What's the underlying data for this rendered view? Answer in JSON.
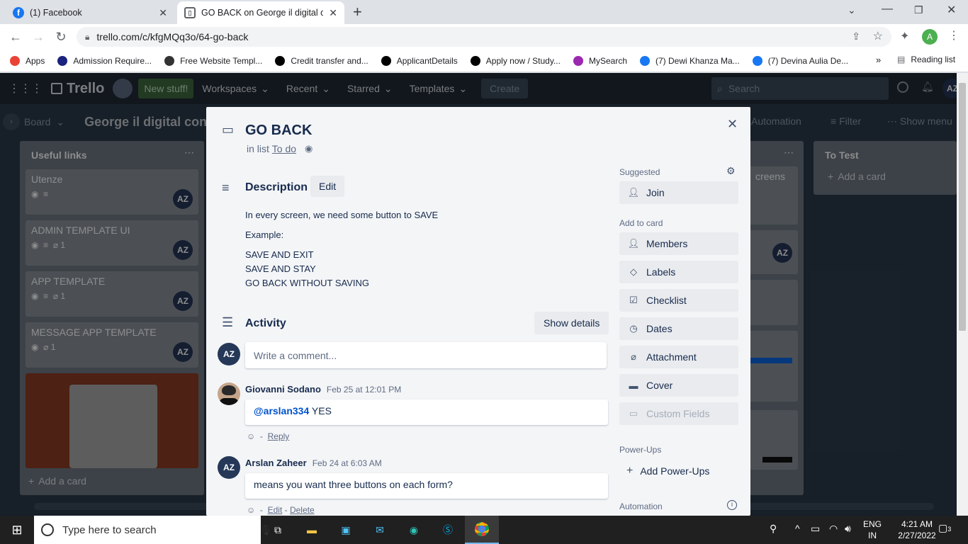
{
  "browser": {
    "tabs": [
      {
        "title": "(1) Facebook",
        "icon": "facebook-icon"
      },
      {
        "title": "GO BACK on George il digital cor",
        "icon": "trello-icon"
      }
    ],
    "url": "trello.com/c/kfgMQq3o/64-go-back",
    "profile_initial": "A",
    "bookmarks": [
      {
        "label": "Apps",
        "color": "#ea4335"
      },
      {
        "label": "Admission Require...",
        "color": "#1a237e"
      },
      {
        "label": "Free Website Templ...",
        "color": "#333333"
      },
      {
        "label": "Credit transfer and...",
        "color": "#000000"
      },
      {
        "label": "ApplicantDetails",
        "color": "#000000"
      },
      {
        "label": "Apply now / Study...",
        "color": "#000000"
      },
      {
        "label": "MySearch",
        "color": "#9c27b0"
      },
      {
        "label": "(7) Dewi Khanza Ma...",
        "color": "#1877f2"
      },
      {
        "label": "(7) Devina Aulia De...",
        "color": "#1877f2"
      }
    ],
    "more_bookmarks": "»",
    "reading_list": "Reading list"
  },
  "trello": {
    "logo": "Trello",
    "new_stuff": "New stuff!",
    "nav": [
      "Workspaces",
      "Recent",
      "Starred",
      "Templates"
    ],
    "create": "Create",
    "search_placeholder": "Search",
    "user_initials": "AZ",
    "board_view": "Board",
    "board_title": "George il digital con",
    "automation": "Automation",
    "filter": "Filter",
    "show_menu": "Show menu",
    "list1": {
      "title": "Useful links",
      "cards": [
        {
          "title": "Utenze",
          "badge": ""
        },
        {
          "title": "ADMIN TEMPLATE UI",
          "badge": "1"
        },
        {
          "title": "APP TEMPLATE",
          "badge": "1"
        },
        {
          "title": "MESSAGE APP TEMPLATE",
          "badge": "1"
        }
      ],
      "add_card": "Add a card"
    },
    "list2_fragment": "creens",
    "list3": {
      "title": "To Test",
      "add_card": "Add a card"
    }
  },
  "card": {
    "title": "GO BACK",
    "in_list_prefix": "in list",
    "list_name": "To do",
    "description_heading": "Description",
    "edit": "Edit",
    "description": [
      "In every screen, we need some button to SAVE",
      "Example:",
      "SAVE AND EXIT",
      "SAVE AND STAY",
      "GO BACK WITHOUT SAVING"
    ],
    "activity_heading": "Activity",
    "show_details": "Show details",
    "comment_placeholder": "Write a comment...",
    "current_user": "AZ",
    "comments": [
      {
        "author": "Giovanni Sodano",
        "time": "Feb 25 at 12:01 PM",
        "mention": "@arslan334",
        "text": " YES",
        "actions": [
          "Reply"
        ]
      },
      {
        "author": "Arslan Zaheer",
        "initials": "AZ",
        "time": "Feb 24 at 6:03 AM",
        "mention": "",
        "text": "means you want three buttons on each form?",
        "actions": [
          "Edit",
          "Delete"
        ]
      }
    ],
    "sidebar": {
      "suggested": "Suggested",
      "join": "Join",
      "add_to_card": "Add to card",
      "add_items": [
        {
          "label": "Members",
          "icon": "person-icon"
        },
        {
          "label": "Labels",
          "icon": "label-icon"
        },
        {
          "label": "Checklist",
          "icon": "checklist-icon"
        },
        {
          "label": "Dates",
          "icon": "clock-icon"
        },
        {
          "label": "Attachment",
          "icon": "paperclip-icon"
        },
        {
          "label": "Cover",
          "icon": "cover-icon"
        },
        {
          "label": "Custom Fields",
          "icon": "custom-fields-icon"
        }
      ],
      "power_ups": "Power-Ups",
      "add_power_ups": "Add Power-Ups",
      "automation": "Automation"
    }
  },
  "taskbar": {
    "search_placeholder": "Type here to search",
    "lang": "ENG",
    "region": "IN",
    "time": "4:21 AM",
    "date": "2/27/2022",
    "notifications": "3"
  }
}
